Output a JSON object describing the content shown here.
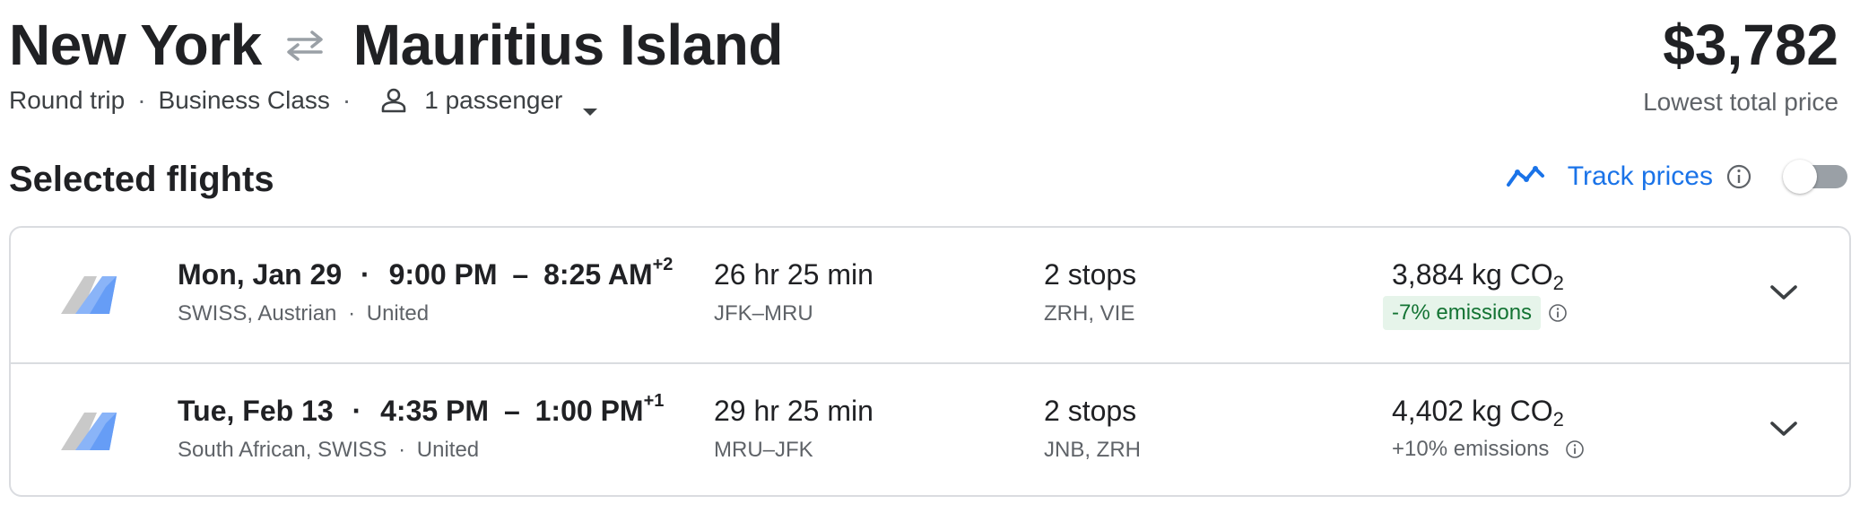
{
  "header": {
    "origin": "New York",
    "destination": "Mauritius Island",
    "swap_icon": "swap-arrows-icon",
    "trip_type": "Round trip",
    "cabin_class": "Business Class",
    "passengers": "1 passenger",
    "price": "$3,782",
    "price_label": "Lowest total price"
  },
  "section": {
    "title": "Selected flights"
  },
  "track": {
    "label": "Track prices",
    "enabled": false,
    "accent": "#1a73e8"
  },
  "flights": [
    {
      "date": "Mon, Jan 29",
      "depart": "9:00 PM",
      "arrive": "8:25 AM",
      "day_offset": "+2",
      "airlines": "SWISS, Austrian",
      "operator": "United",
      "duration": "26 hr 25 min",
      "airports": "JFK–MRU",
      "stops": "2 stops",
      "layovers": "ZRH, VIE",
      "co2_value": "3,884 kg CO",
      "co2_sub": "2",
      "emissions": "-7% emissions",
      "emissions_color": "#137333"
    },
    {
      "date": "Tue, Feb 13",
      "depart": "4:35 PM",
      "arrive": "1:00 PM",
      "day_offset": "+1",
      "airlines": "South African, SWISS",
      "operator": "United",
      "duration": "29 hr 25 min",
      "airports": "MRU–JFK",
      "stops": "2 stops",
      "layovers": "JNB, ZRH",
      "co2_value": "4,402 kg CO",
      "co2_sub": "2",
      "emissions": "+10% emissions",
      "emissions_color": "#5f6368"
    }
  ],
  "separators": {
    "dot": "·",
    "dash": "–"
  }
}
